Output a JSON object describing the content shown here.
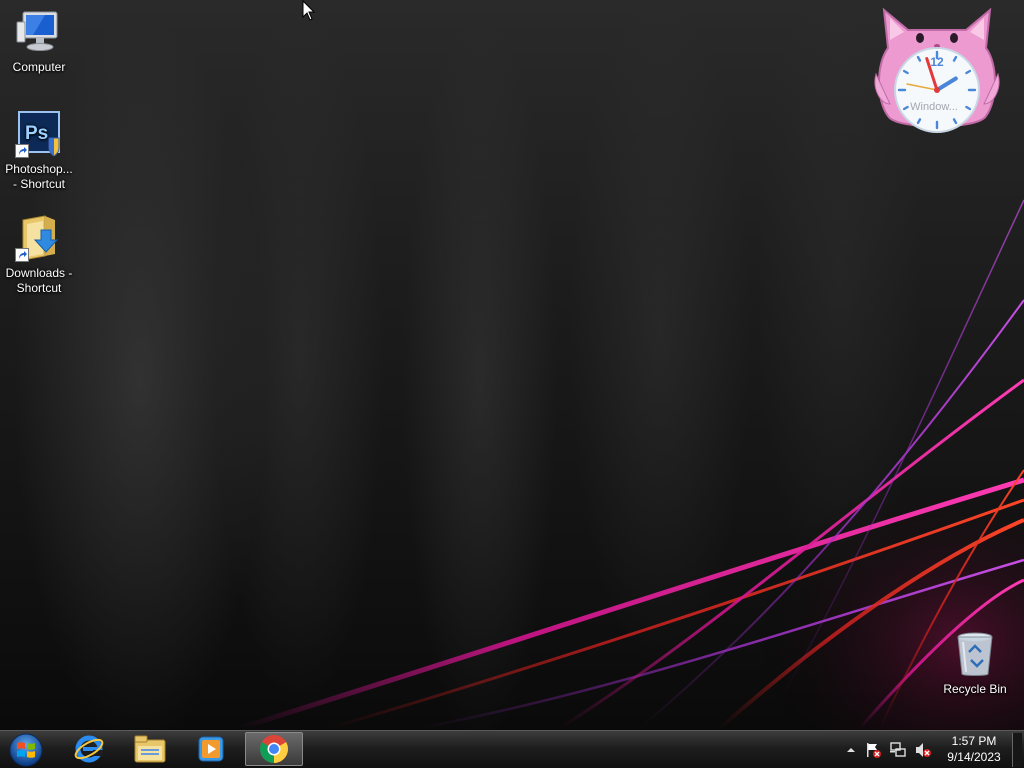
{
  "desktop": {
    "icons": [
      {
        "label": "Computer",
        "icon": "computer-icon"
      },
      {
        "label": "Photoshop... - Shortcut",
        "label_line1": "Photoshop...",
        "label_line2": "- Shortcut",
        "icon": "photoshop-icon"
      },
      {
        "label": "Downloads - Shortcut",
        "label_line1": "Downloads -",
        "label_line2": "Shortcut",
        "icon": "downloads-folder-icon"
      },
      {
        "label": "Recycle Bin",
        "icon": "recycle-bin-icon"
      }
    ],
    "clock_gadget": {
      "caption": "Window...",
      "numeral": "12",
      "time": {
        "hour": 1,
        "minute": 57
      }
    }
  },
  "taskbar": {
    "start_button": {
      "icon": "windows-logo-icon"
    },
    "pinned": [
      {
        "icon": "internet-explorer-icon",
        "active": false
      },
      {
        "icon": "file-explorer-icon",
        "active": false
      },
      {
        "icon": "media-player-icon",
        "active": false
      },
      {
        "icon": "chrome-icon",
        "active": true
      }
    ],
    "tray": {
      "icons": [
        "show-hidden-icons-chevron-icon",
        "action-center-flag-icon",
        "network-icon",
        "volume-muted-icon"
      ]
    },
    "clock": {
      "time": "1:57 PM",
      "date": "9/14/2023"
    }
  },
  "colors": {
    "accent_magenta": "#d0148c",
    "accent_red": "#c81e1e",
    "accent_purple": "#8c28b4"
  }
}
